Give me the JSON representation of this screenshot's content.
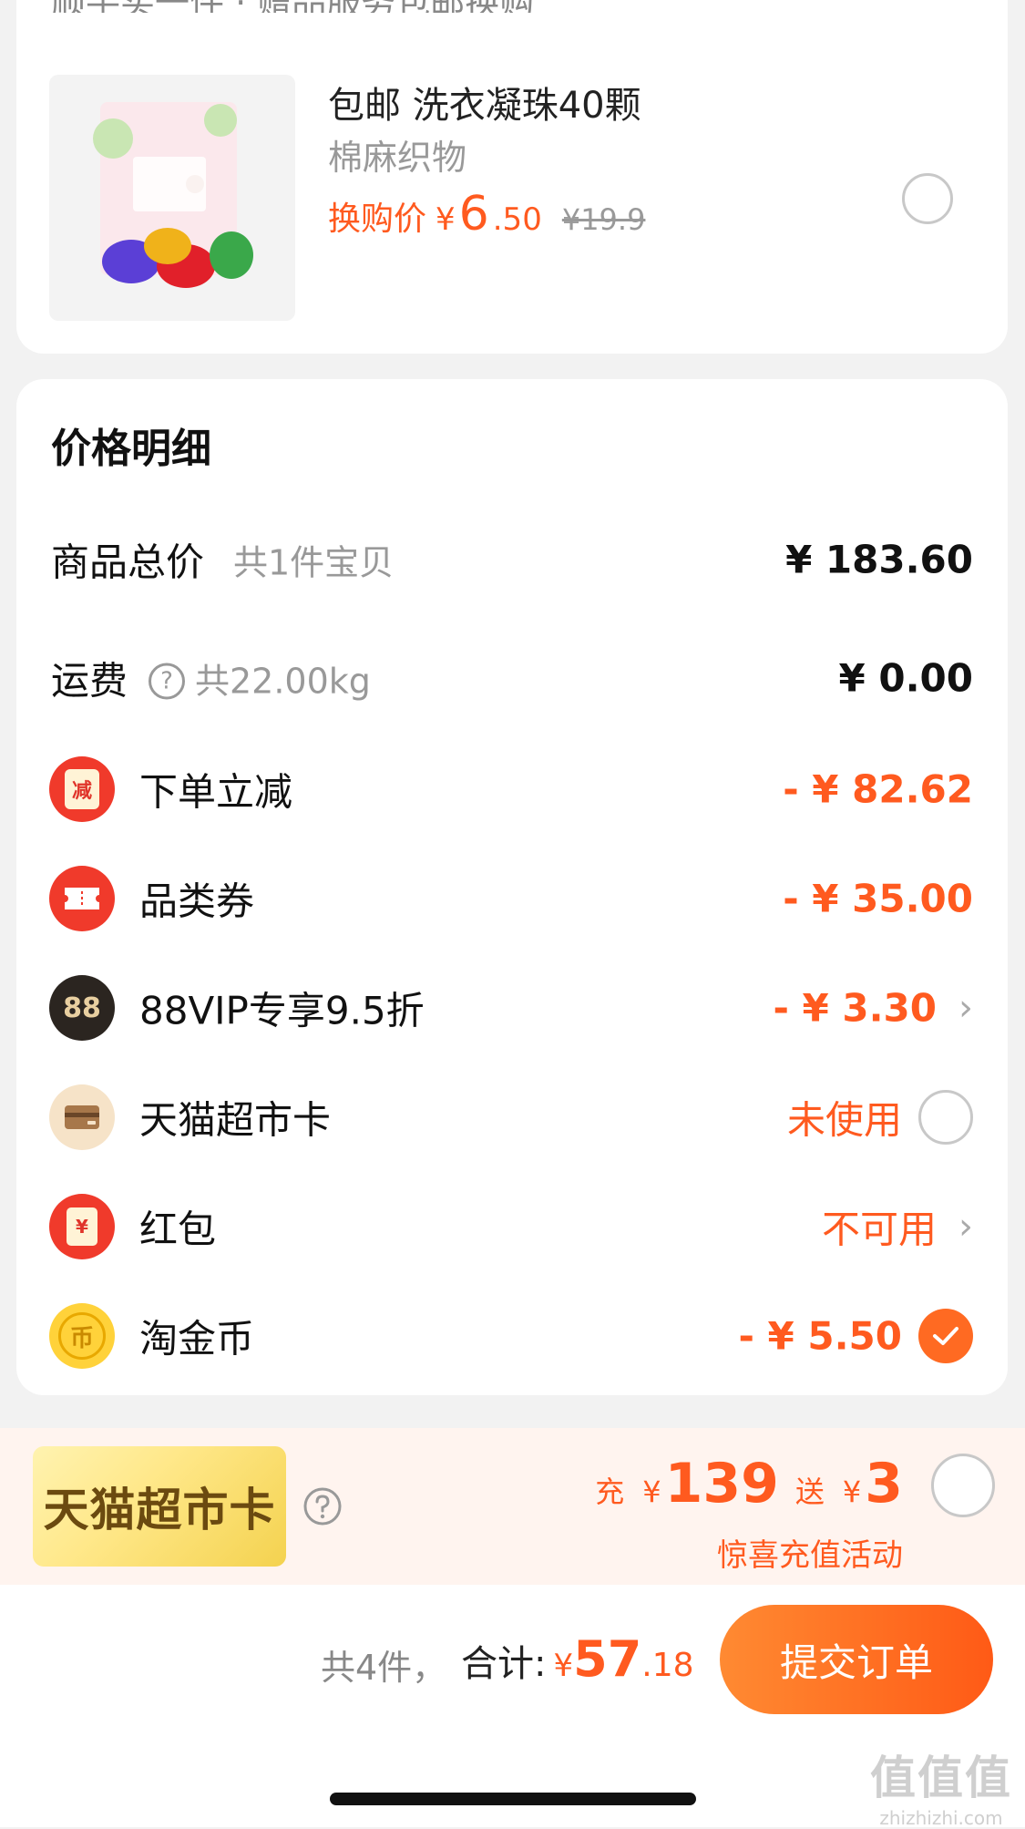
{
  "top_card": {
    "clipped_header": "顺手买一件 · 赠品服务包邮换购",
    "product": {
      "title": "包邮 洗衣凝珠40颗",
      "subtitle": "棉麻织物",
      "price_label": "换购价",
      "price_currency": "¥",
      "price_int": "6",
      "price_dec": ".50",
      "original_price": "¥19.9"
    }
  },
  "price_detail": {
    "title": "价格明细",
    "goods_total": {
      "label": "商品总价",
      "sub": "共1件宝贝",
      "amount": "¥ 183.60"
    },
    "shipping": {
      "label": "运费",
      "help_glyph": "?",
      "sub": "共22.00kg",
      "amount": "¥ 0.00"
    },
    "instant_discount": {
      "label": "下单立减",
      "icon_text": "减",
      "amount": "- ¥ 82.62"
    },
    "category_coupon": {
      "label": "品类券",
      "amount": "- ¥ 35.00"
    },
    "vip": {
      "label": "88VIP专享9.5折",
      "icon_text": "88",
      "amount": "- ¥ 3.30"
    },
    "market_card": {
      "label": "天猫超市卡",
      "amount": "未使用"
    },
    "red_packet": {
      "label": "红包",
      "icon_text": "¥",
      "amount": "不可用"
    },
    "tao_coins": {
      "label": "淘金币",
      "icon_text": "币",
      "amount": "- ¥ 5.50"
    },
    "chevron": "›"
  },
  "promo": {
    "card_text": "天猫超市卡",
    "recharge_prefix": "充",
    "recharge_yen": "¥",
    "recharge_amount": "139",
    "gift_prefix": "送",
    "gift_yen": "¥",
    "gift_amount": "3",
    "activity_text": "惊喜充值活动"
  },
  "footer": {
    "count_text": "共4件，",
    "total_label": "合计:",
    "total_currency": "¥",
    "total_int": "57",
    "total_dec": ".18",
    "submit_label": "提交订单"
  },
  "watermark": {
    "main": "值值值",
    "sub": "zhizhizhi.com"
  },
  "colors": {
    "accent": "#ff5a1f",
    "background": "#f2f2f2",
    "promo_bg": "#fff4ef"
  }
}
